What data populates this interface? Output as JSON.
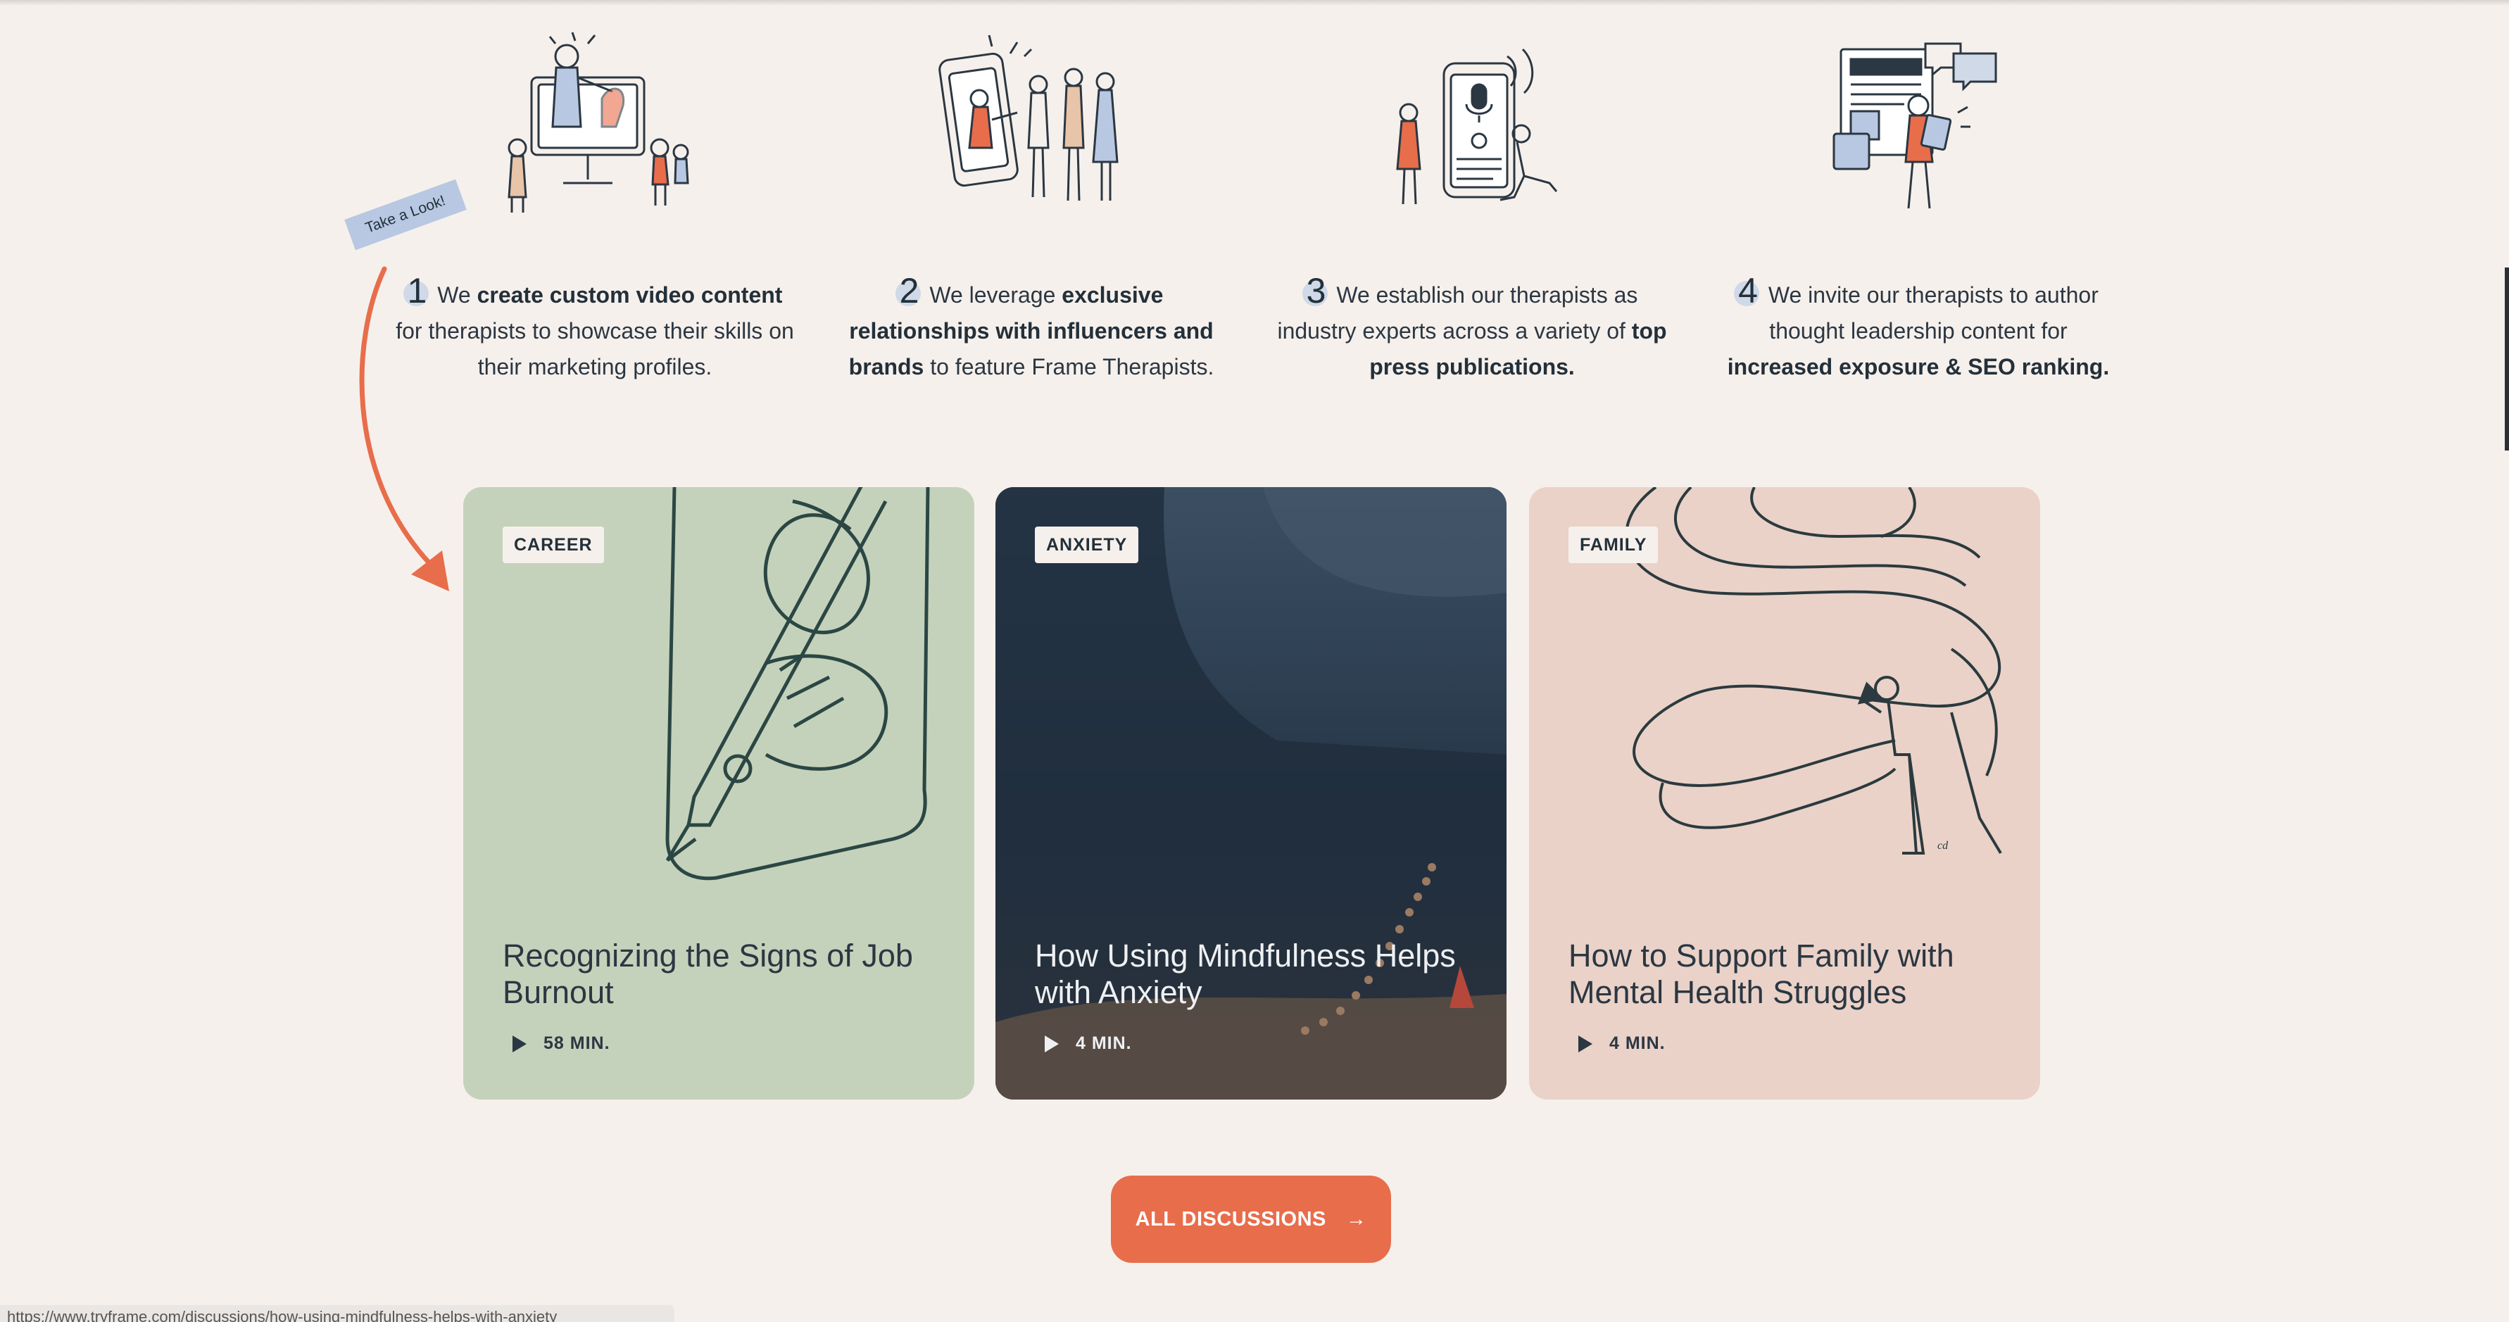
{
  "steps": [
    {
      "number": "1",
      "parts": [
        {
          "t": "We ",
          "b": false
        },
        {
          "t": "create custom video content",
          "b": true
        },
        {
          "t": " for therapists to showcase their skills on their marketing profiles.",
          "b": false
        }
      ]
    },
    {
      "number": "2",
      "parts": [
        {
          "t": "We leverage ",
          "b": false
        },
        {
          "t": "exclusive relationships with influencers and brands",
          "b": true
        },
        {
          "t": " to feature Frame Therapists.",
          "b": false
        }
      ]
    },
    {
      "number": "3",
      "parts": [
        {
          "t": "We establish our therapists as industry experts across a variety of ",
          "b": false
        },
        {
          "t": "top press publications.",
          "b": true
        }
      ]
    },
    {
      "number": "4",
      "parts": [
        {
          "t": "We invite our therapists to author thought leadership content for ",
          "b": false
        },
        {
          "t": "increased exposure & SEO ranking.",
          "b": true
        }
      ]
    }
  ],
  "look_tag": "Take a Look!",
  "cards": [
    {
      "tag": "CAREER",
      "title": "Recognizing the Signs of Job Burnout",
      "duration": "58 MIN."
    },
    {
      "tag": "ANXIETY",
      "title": "How Using Mindfulness Helps with Anxiety",
      "duration": "4 MIN."
    },
    {
      "tag": "FAMILY",
      "title": "How to Support Family with Mental Health Struggles",
      "duration": "4 MIN."
    }
  ],
  "button": {
    "label": "ALL DISCUSSIONS",
    "arrow": "→"
  },
  "status_url": "https://www.tryframe.com/discussions/how-using-mindfulness-helps-with-anxiety",
  "colors": {
    "background": "#f6f0ec",
    "accent": "#e86d4b",
    "ink": "#23303a",
    "card_career": "#c5d2bb",
    "card_anxiety": "#27384a",
    "card_family": "#ead2c8"
  },
  "icons": [
    "video-illustration-icon",
    "influencers-illustration-icon",
    "press-illustration-icon",
    "author-illustration-icon",
    "play-icon",
    "arrow-right-icon"
  ]
}
